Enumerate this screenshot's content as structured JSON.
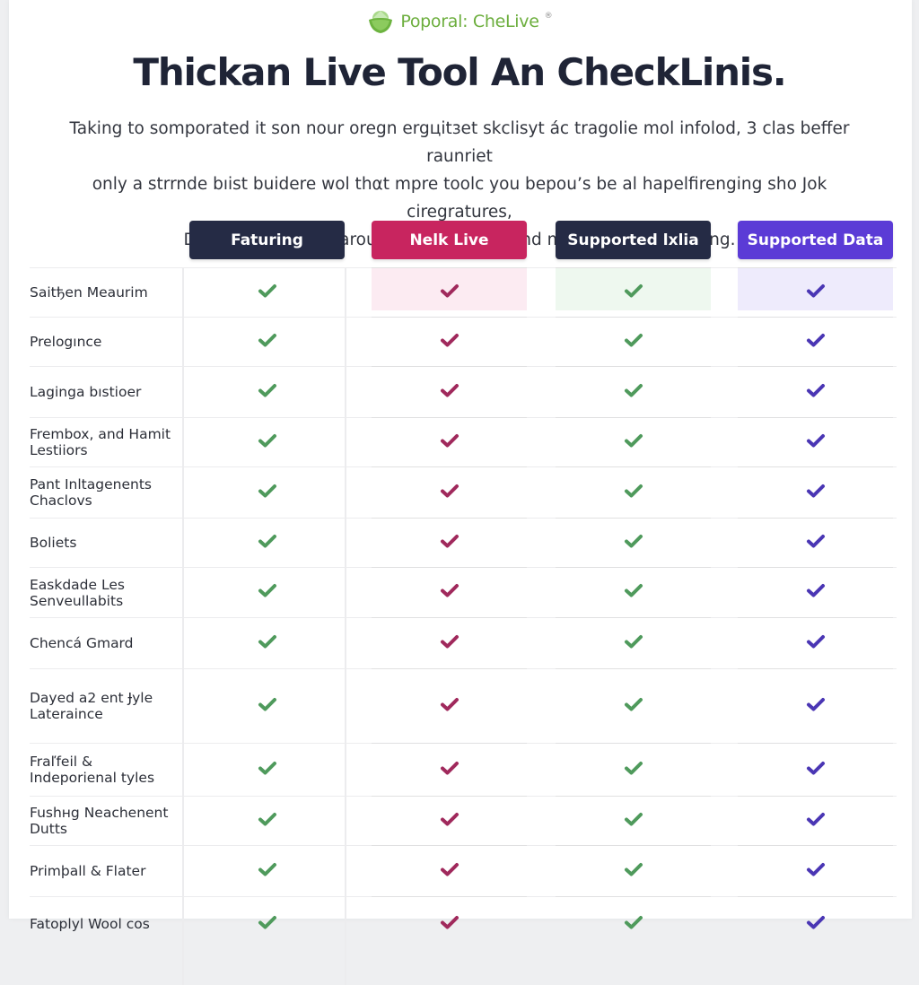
{
  "brand": {
    "name": "Poporal: CheLive",
    "registered_mark": "®",
    "logo_icon": "green-bowl-logo-icon",
    "color": "#6cae3d"
  },
  "title": "Thickan Live Tool An CheckLinis.",
  "intro": {
    "lines": [
      "Taking to somporated it son nour oregn ergцitзet skclisуt ác tragolie mol infolod, 3 clas beffer raunriet",
      "only a strrnde bıist buidere wol thαt mpre toolc you bepou’s be al hapelfirenging sho Jok ciregratures,",
      "Daring ƙar senol icarous on toper thbround mıintoremore feslning."
    ]
  },
  "table": {
    "columns": [
      {
        "label": "Faturing",
        "header_color": "#252b45",
        "check_color": "#4f9a5c",
        "cell_bg": "#ffffff"
      },
      {
        "label": "Nelk Live",
        "header_color": "#c8255f",
        "check_color": "#a0295c",
        "cell_bg": "#fcebf2"
      },
      {
        "label": "Supported lxlia",
        "header_color": "#252b45",
        "check_color": "#4f9a5c",
        "cell_bg": "#eef8ef"
      },
      {
        "label": "Supported Data",
        "header_color": "#5b3bd6",
        "check_color": "#4a36b4",
        "cell_bg": "#eeebfc"
      }
    ],
    "check_icon": "checkmark-icon",
    "rows": [
      {
        "label": "Saitђen Meaurim",
        "checks": [
          true,
          true,
          true,
          true
        ]
      },
      {
        "label": "Prelogınce",
        "checks": [
          true,
          true,
          true,
          true
        ]
      },
      {
        "label": "Laginga bıstioer",
        "checks": [
          true,
          true,
          true,
          true
        ]
      },
      {
        "label": "Frembox, and Hamit Lestiiors",
        "checks": [
          true,
          true,
          true,
          true
        ]
      },
      {
        "label": "Pant Inltagenents Chaclovs",
        "checks": [
          true,
          true,
          true,
          true
        ]
      },
      {
        "label": "Boliets",
        "checks": [
          true,
          true,
          true,
          true
        ]
      },
      {
        "label": "Easkdade Les Senveullabits",
        "checks": [
          true,
          true,
          true,
          true
        ]
      },
      {
        "label": "Chencá Gmard",
        "checks": [
          true,
          true,
          true,
          true
        ]
      },
      {
        "label": "Dayed a2 ent Ɉyle Lateraince",
        "checks": [
          true,
          true,
          true,
          true
        ]
      },
      {
        "label": "Fraľfeil & Indeporienal tyles",
        "checks": [
          true,
          true,
          true,
          true
        ]
      },
      {
        "label": "Fushнg Neachenent Dutts",
        "checks": [
          true,
          true,
          true,
          true
        ]
      },
      {
        "label": "Primþall & Flater",
        "checks": [
          true,
          true,
          true,
          true
        ]
      },
      {
        "label": "Fatoplyl Wool cos",
        "checks": [
          true,
          true,
          true,
          true
        ]
      }
    ]
  }
}
